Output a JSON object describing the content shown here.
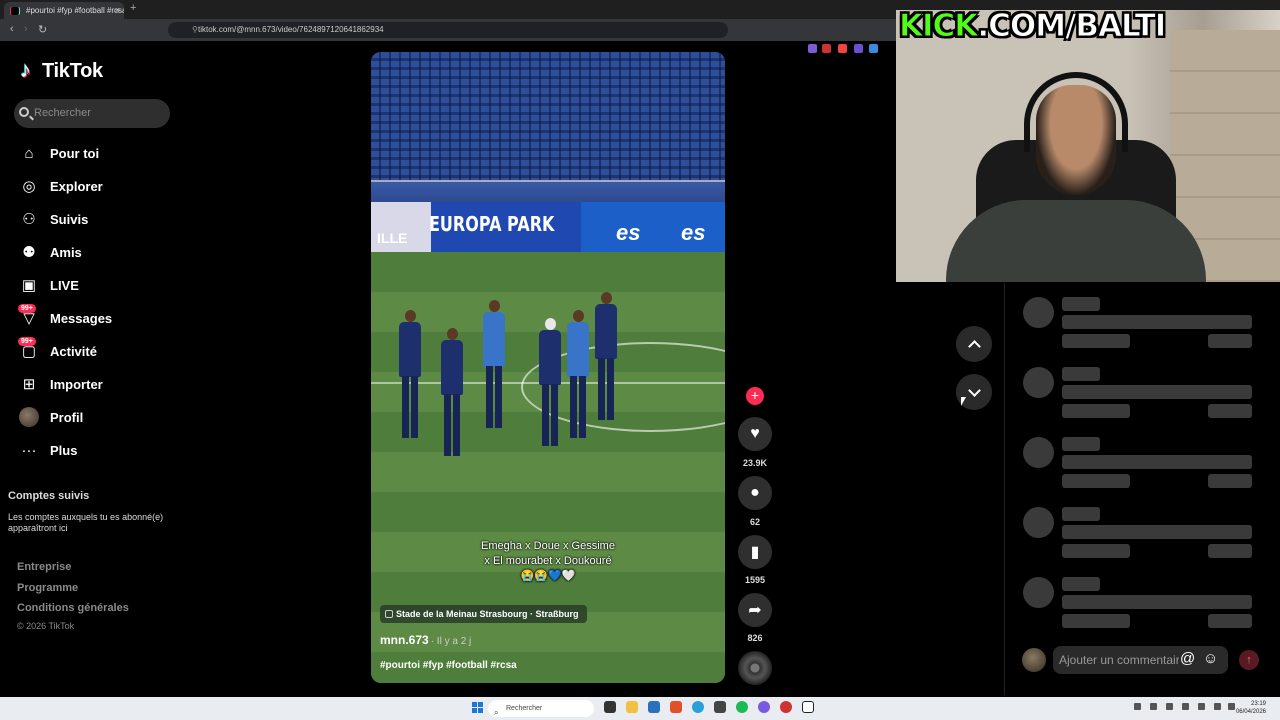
{
  "browser": {
    "tab_title": "#pourtoi #fyp #football #rcsa",
    "tab_close": "×",
    "new_tab": "+",
    "url": "tiktok.com/@mnn.673/video/7624897120641862934"
  },
  "sidebar": {
    "logo": "TikTok",
    "search_placeholder": "Rechercher",
    "items": [
      {
        "label": "Pour toi",
        "icon": "home-icon"
      },
      {
        "label": "Explorer",
        "icon": "compass-icon"
      },
      {
        "label": "Suivis",
        "icon": "user-follow-icon"
      },
      {
        "label": "Amis",
        "icon": "friends-icon"
      },
      {
        "label": "LIVE",
        "icon": "live-tv-icon"
      },
      {
        "label": "Messages",
        "icon": "messages-icon",
        "badge": "99+"
      },
      {
        "label": "Activité",
        "icon": "activity-icon",
        "badge": "99+"
      },
      {
        "label": "Importer",
        "icon": "upload-icon"
      },
      {
        "label": "Profil",
        "icon": "avatar"
      },
      {
        "label": "Plus",
        "icon": "more-icon"
      }
    ],
    "followed_heading": "Comptes suivis",
    "followed_text": "Les comptes auxquels tu es abonné(e) apparaîtront ici",
    "footer": [
      "Entreprise",
      "Programme",
      "Conditions générales"
    ],
    "copyright": "© 2026 TikTok"
  },
  "video": {
    "caption_line1": "Emegha x  Doue x Gessime",
    "caption_line2": "x El mourabet x Doukouré",
    "caption_emoji": "😭😭💙🤍",
    "location": "Stade de la Meinau Strasbourg · Straßburg",
    "author": "mnn.673",
    "time_ago": "· Il y a 2 j",
    "hashtags": "#pourtoi #fyp #football #rcsa",
    "ad_left": "ILLE",
    "ad_center": "EUROPA PARK",
    "ad_right1": "es",
    "ad_right2": "es"
  },
  "actions": {
    "likes": "23.9K",
    "comments": "62",
    "saves": "1595",
    "shares": "826"
  },
  "overlay": {
    "kick_green": "KICK",
    "kick_white": ".COM/BALTI"
  },
  "comments": {
    "input_placeholder": "Ajouter un commentaire...",
    "mention_icon": "@",
    "emoji_icon": "☺"
  },
  "taskbar": {
    "search_placeholder": "Rechercher",
    "time": "23:19",
    "date": "06/04/2026"
  },
  "colors": {
    "tiktok_red": "#fe2c55",
    "kick_green": "#53fc18"
  }
}
